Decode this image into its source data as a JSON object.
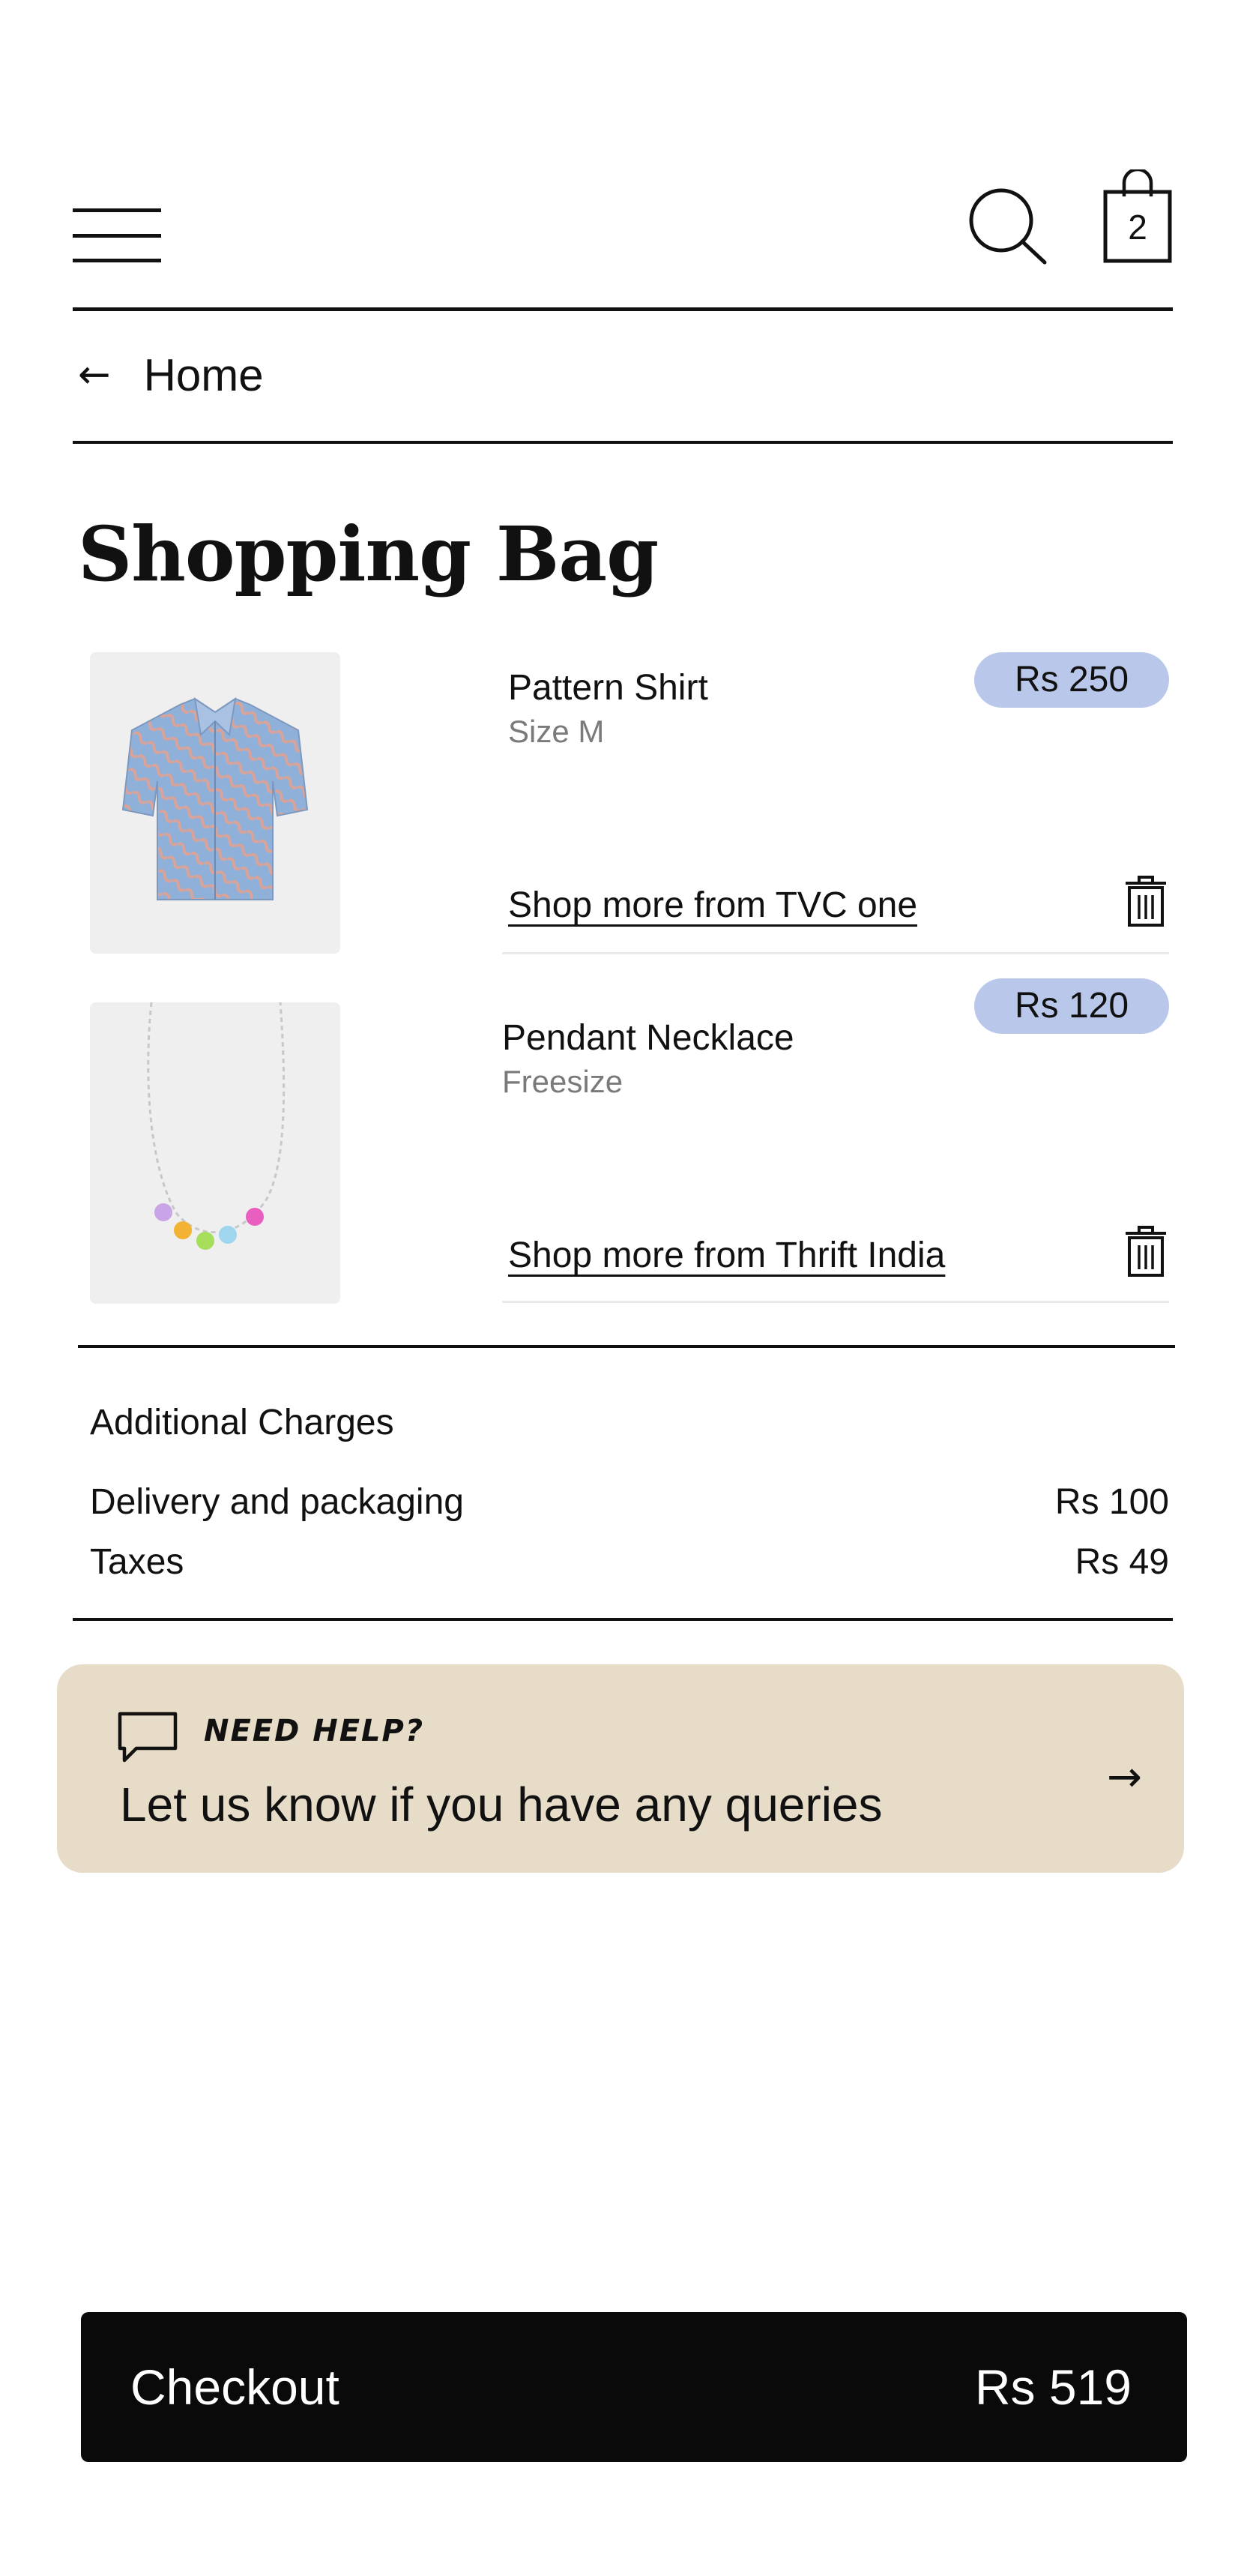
{
  "header": {
    "menu_icon": "hamburger-menu-icon",
    "search_icon": "search-icon",
    "bag_icon": "shopping-bag-icon",
    "bag_count": "2"
  },
  "breadcrumb": {
    "arrow": "←",
    "label": "Home"
  },
  "page_title": "Shopping Bag",
  "items": [
    {
      "name": "Pattern Shirt",
      "variant": "Size M",
      "price": "Rs 250",
      "shop_more": "Shop more from TVC one",
      "image": "patterned-shirt-thumbnail",
      "delete_icon": "trash-icon"
    },
    {
      "name": "Pendant Necklace",
      "variant": "Freesize",
      "price": "Rs 120",
      "shop_more": "Shop more from Thrift India",
      "image": "pendant-necklace-thumbnail",
      "delete_icon": "trash-icon"
    }
  ],
  "charges": {
    "title": "Additional Charges",
    "rows": [
      {
        "label": "Delivery and packaging",
        "value": "Rs 100"
      },
      {
        "label": "Taxes",
        "value": "Rs 49"
      }
    ]
  },
  "help": {
    "icon": "chat-bubble-icon",
    "kicker": "NEED HELP?",
    "text": "Let us know if you have any queries",
    "arrow": "→"
  },
  "checkout": {
    "label": "Checkout",
    "total": "Rs 519"
  },
  "colors": {
    "price_badge": "#b9c8ea",
    "help_card": "#e6dcc8",
    "checkout_bg": "#0a0a0a"
  }
}
